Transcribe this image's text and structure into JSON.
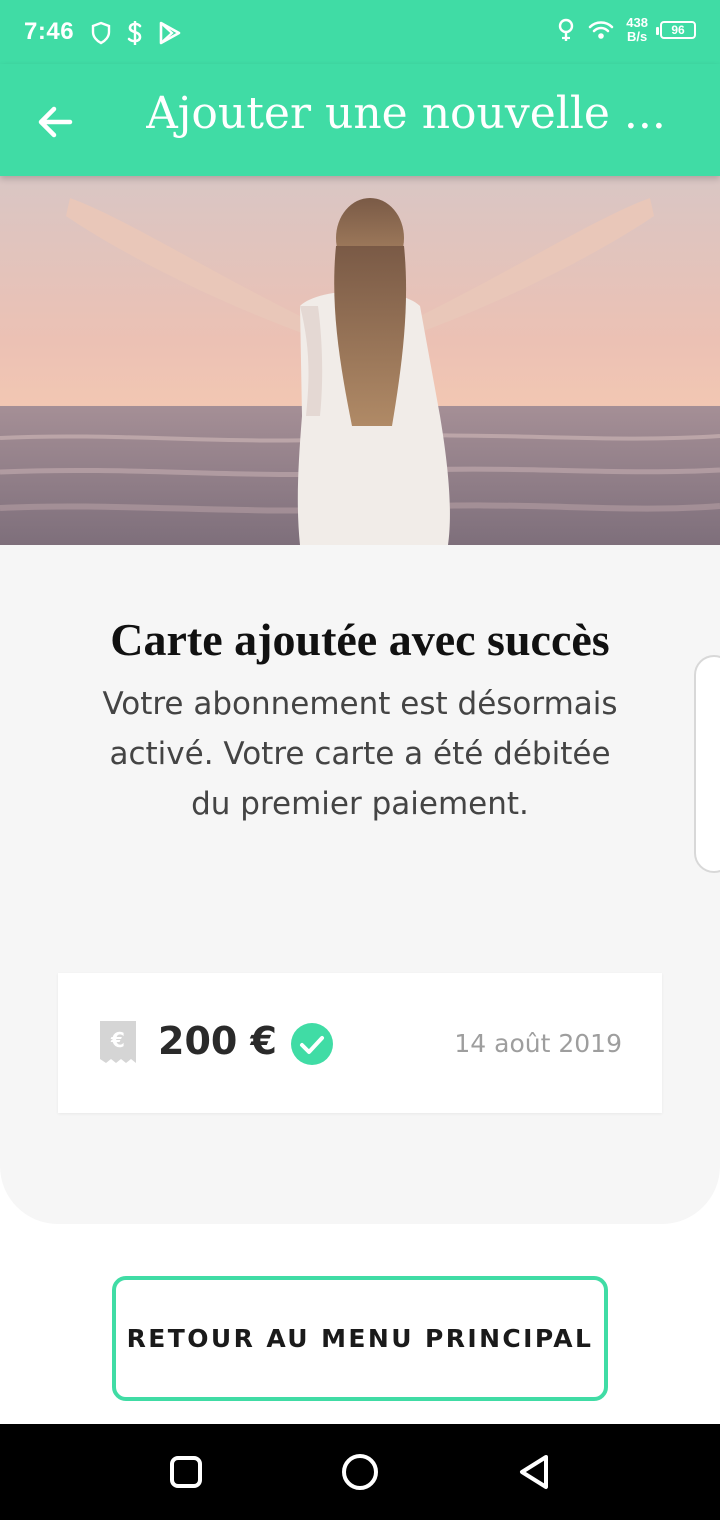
{
  "status_bar": {
    "time": "7:46",
    "net_speed_value": "438",
    "net_speed_unit": "B/s",
    "battery": "96",
    "left_icons": [
      "shield-icon",
      "dollar-icon",
      "play-store-icon"
    ],
    "right_icons": [
      "location-icon",
      "wifi-icon",
      "battery-icon"
    ]
  },
  "app_bar": {
    "title": "Ajouter une nouvelle ...",
    "back_icon": "arrow-left-icon"
  },
  "hero": {
    "image": "woman-arms-raised-at-sea-photo"
  },
  "panel": {
    "title": "Carte ajoutée avec succès",
    "message": "Votre abonnement est désormais activé. Votre carte a été débitée du premier paiement."
  },
  "payment": {
    "icon": "euro-receipt-icon",
    "amount": "200 €",
    "status_icon": "check-circle-icon",
    "date": "14 août 2019"
  },
  "actions": {
    "back_to_menu_label": "RETOUR AU MENU PRINCIPAL"
  },
  "nav_bar": {
    "buttons": [
      "recents-square-icon",
      "home-circle-icon",
      "back-triangle-icon"
    ]
  },
  "colors": {
    "accent": "#40dca5",
    "panel_background": "#f6f6f6",
    "nav_background": "#000000"
  }
}
